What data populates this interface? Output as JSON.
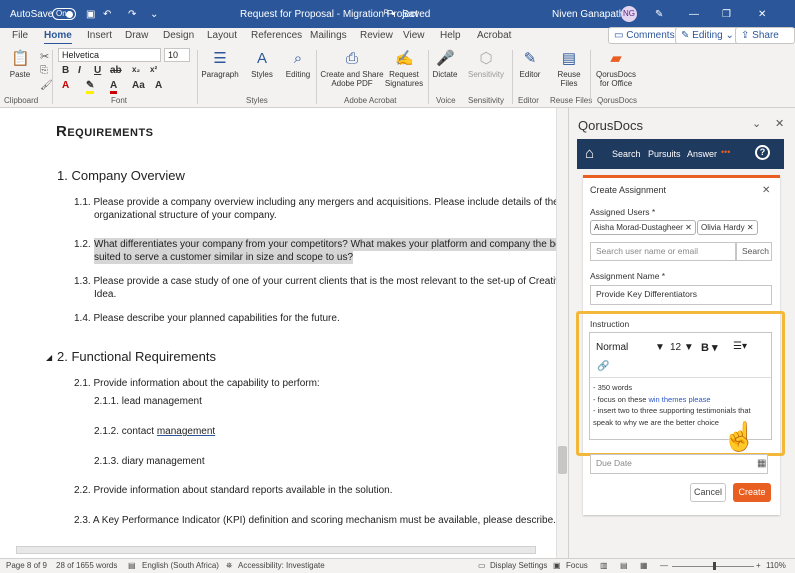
{
  "titlebar": {
    "autosave": "AutoSave",
    "toggle": "On",
    "doc_title": "Request for Proposal - Migration Project",
    "saved": "Saved",
    "user": "Niven Ganapathee",
    "initials": "NG"
  },
  "tabs": [
    "File",
    "Home",
    "Insert",
    "Draw",
    "Design",
    "Layout",
    "References",
    "Mailings",
    "Review",
    "View",
    "Help",
    "Acrobat"
  ],
  "actions": {
    "comments": "Comments",
    "editing": "Editing",
    "share": "Share"
  },
  "ribbon": {
    "paste": "Paste",
    "font_name": "Helvetica",
    "font_size": "10",
    "paragraph": "Paragraph",
    "styles": "Styles",
    "editing": "Editing",
    "create_share": "Create and Share Adobe PDF",
    "request_sig": "Request Signatures",
    "dictate": "Dictate",
    "sensitivity": "Sensitivity",
    "editor": "Editor",
    "reuse": "Reuse Files",
    "qorus": "QorusDocs for Office",
    "groups": {
      "clipboard": "Clipboard",
      "font": "Font",
      "styles": "Styles",
      "adobe": "Adobe Acrobat",
      "voice": "Voice",
      "sensitivity": "Sensitivity",
      "editor": "Editor",
      "reuse": "Reuse Files",
      "qorus": "QorusDocs"
    }
  },
  "doc": {
    "heading": "Requirements",
    "s1": "1.  Company Overview",
    "p11": [
      "1.1.  Please provide a company overview including any mergers and acquisitions. Please include details of the",
      "organizational structure of your company."
    ],
    "p12": [
      "1.2.  What differentiates your company from your competitors? What makes your platform and company the best",
      "suited to serve a customer similar in size and scope to us?"
    ],
    "p13": [
      "1.3.  Please provide a case study of one of your current clients that is the most relevant to the set-up of Creative",
      "Idea."
    ],
    "p14": "1.4.  Please describe your planned capabilities for the future.",
    "s2": "2.  Functional Requirements",
    "p21": "2.1.  Provide information about the capability to perform:",
    "p211": "2.1.1.    lead management",
    "p212a": "2.1.2.    contact ",
    "p212b": "management",
    "p213": "2.1.3.    diary management",
    "p22": "2.2.  Provide information about standard reports available in the solution.",
    "p23": "2.3.  A Key Performance Indicator (KPI) definition and scoring mechanism must be available, please describe."
  },
  "pane": {
    "title": "QorusDocs",
    "nav": [
      "Search",
      "Pursuits",
      "Answer"
    ],
    "card_title": "Create Assignment",
    "assigned_label": "Assigned Users *",
    "chips": [
      "Aisha Morad-Dustagheer",
      "Olivia Hardy"
    ],
    "search_placeholder": "Search user name or email",
    "search_btn": "Search",
    "name_label": "Assignment Name *",
    "name_value": "Provide Key Differentiators",
    "instruction_label": "Instruction",
    "style": "Normal",
    "size": "12",
    "instr_lines": [
      "- 350 words",
      "- focus on these ",
      "win themes please",
      "- insert two to three supporting testimonials that",
      "speak to why we are the better choice"
    ],
    "due": "Due Date",
    "cancel": "Cancel",
    "create": "Create"
  },
  "status": {
    "page": "Page 8 of 9",
    "words": "28 of 1655 words",
    "lang": "English (South Africa)",
    "access": "Accessibility: Investigate",
    "display": "Display Settings",
    "focus": "Focus",
    "zoom": "110%"
  },
  "colors": {
    "word_blue": "#2b579a",
    "qorus_nav": "#1f3a5f",
    "accent": "#e95e21",
    "highlight": "#f3b83a"
  }
}
